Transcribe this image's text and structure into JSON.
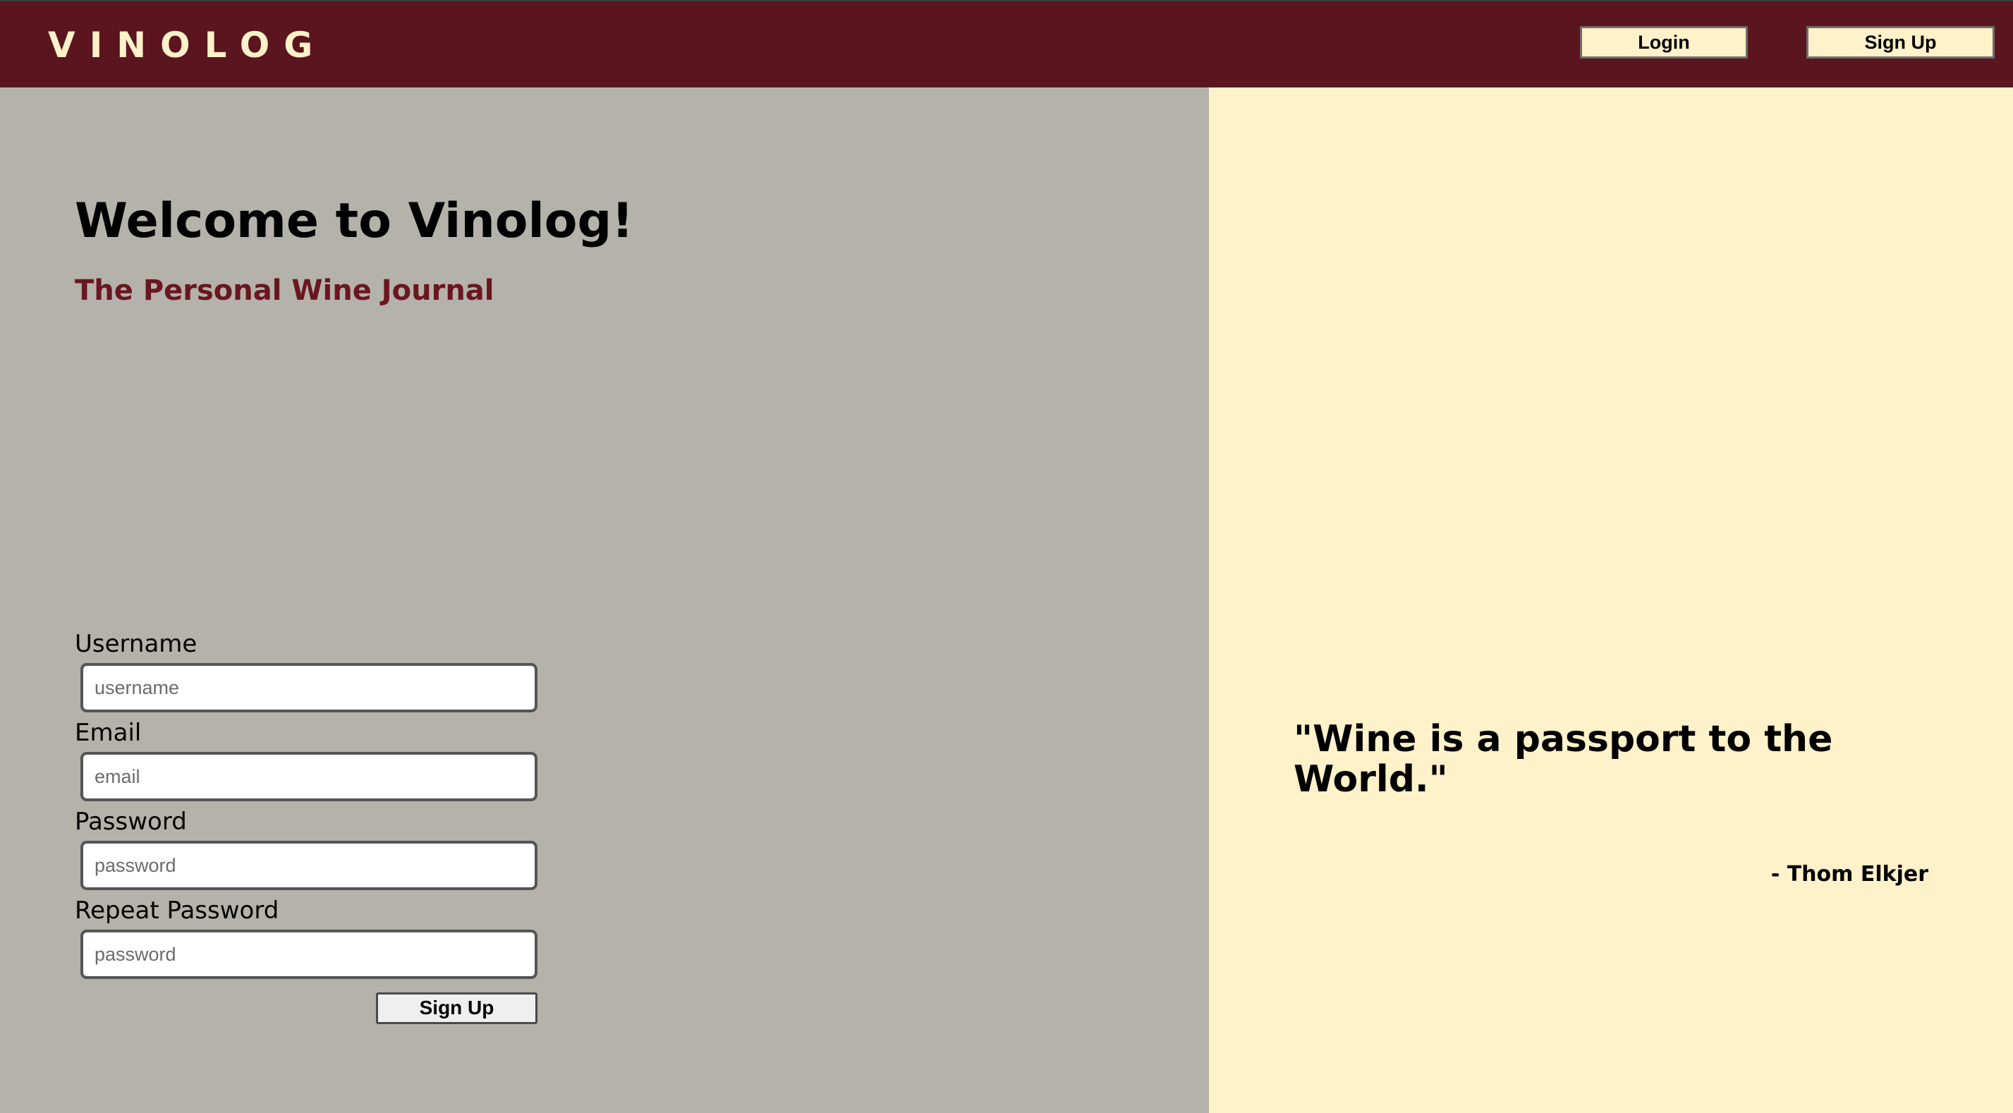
{
  "nav": {
    "brand": "VINOLOG",
    "login_label": "Login",
    "signup_label": "Sign Up"
  },
  "hero": {
    "title": "Welcome to Vinolog!",
    "tagline": "The Personal Wine Journal"
  },
  "form": {
    "username_label": "Username",
    "username_placeholder": "username",
    "username_value": "",
    "email_label": "Email",
    "email_placeholder": "email",
    "email_value": "",
    "password_label": "Password",
    "password_placeholder": "password",
    "password_value": "",
    "repeat_password_label": "Repeat Password",
    "repeat_password_placeholder": "password",
    "repeat_password_value": "",
    "submit_label": "Sign Up"
  },
  "quote": {
    "text": "\"Wine is a passport to the World.\"",
    "author": "- Thom Elkjer"
  },
  "colors": {
    "navbar": "#5b151e",
    "brand_text": "#fff1c9",
    "left_panel": "#b4b2aa",
    "right_panel": "#fff1c9",
    "tagline": "#6a1620"
  }
}
